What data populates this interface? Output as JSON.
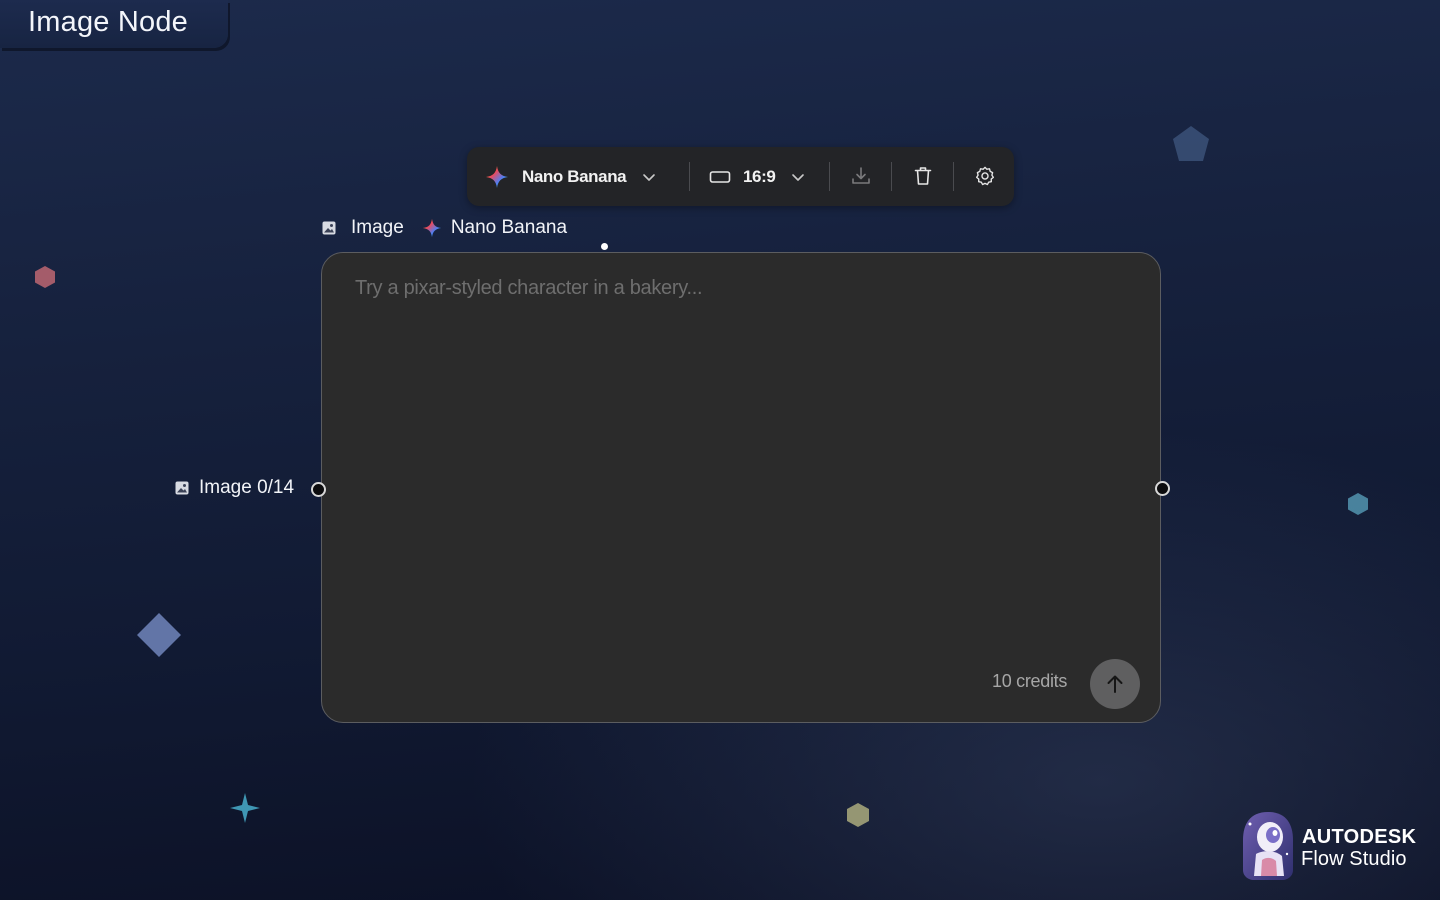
{
  "page": {
    "title": "Image Node"
  },
  "toolbar": {
    "model_label": "Nano Banana",
    "aspect_ratio": "16:9",
    "icons": [
      "sparkle-icon",
      "chevron-down-icon",
      "aspect-ratio-icon",
      "download-icon",
      "trash-icon",
      "gear-icon"
    ]
  },
  "node": {
    "type_label": "Image",
    "model_label": "Nano Banana",
    "prompt": {
      "value": "",
      "placeholder": "Try a pixar-styled character in a bakery..."
    },
    "credits": "10 credits",
    "input_port_label": "Image 0/14"
  },
  "brand": {
    "line1": "AUTODESK",
    "line2": "Flow Studio"
  },
  "colors": {
    "background_top": "#1c2a4b",
    "background_bottom": "#0b1024",
    "toolbar_bg": "#232427",
    "card_bg": "#2b2b2b",
    "send_button": "#5f5f60"
  }
}
